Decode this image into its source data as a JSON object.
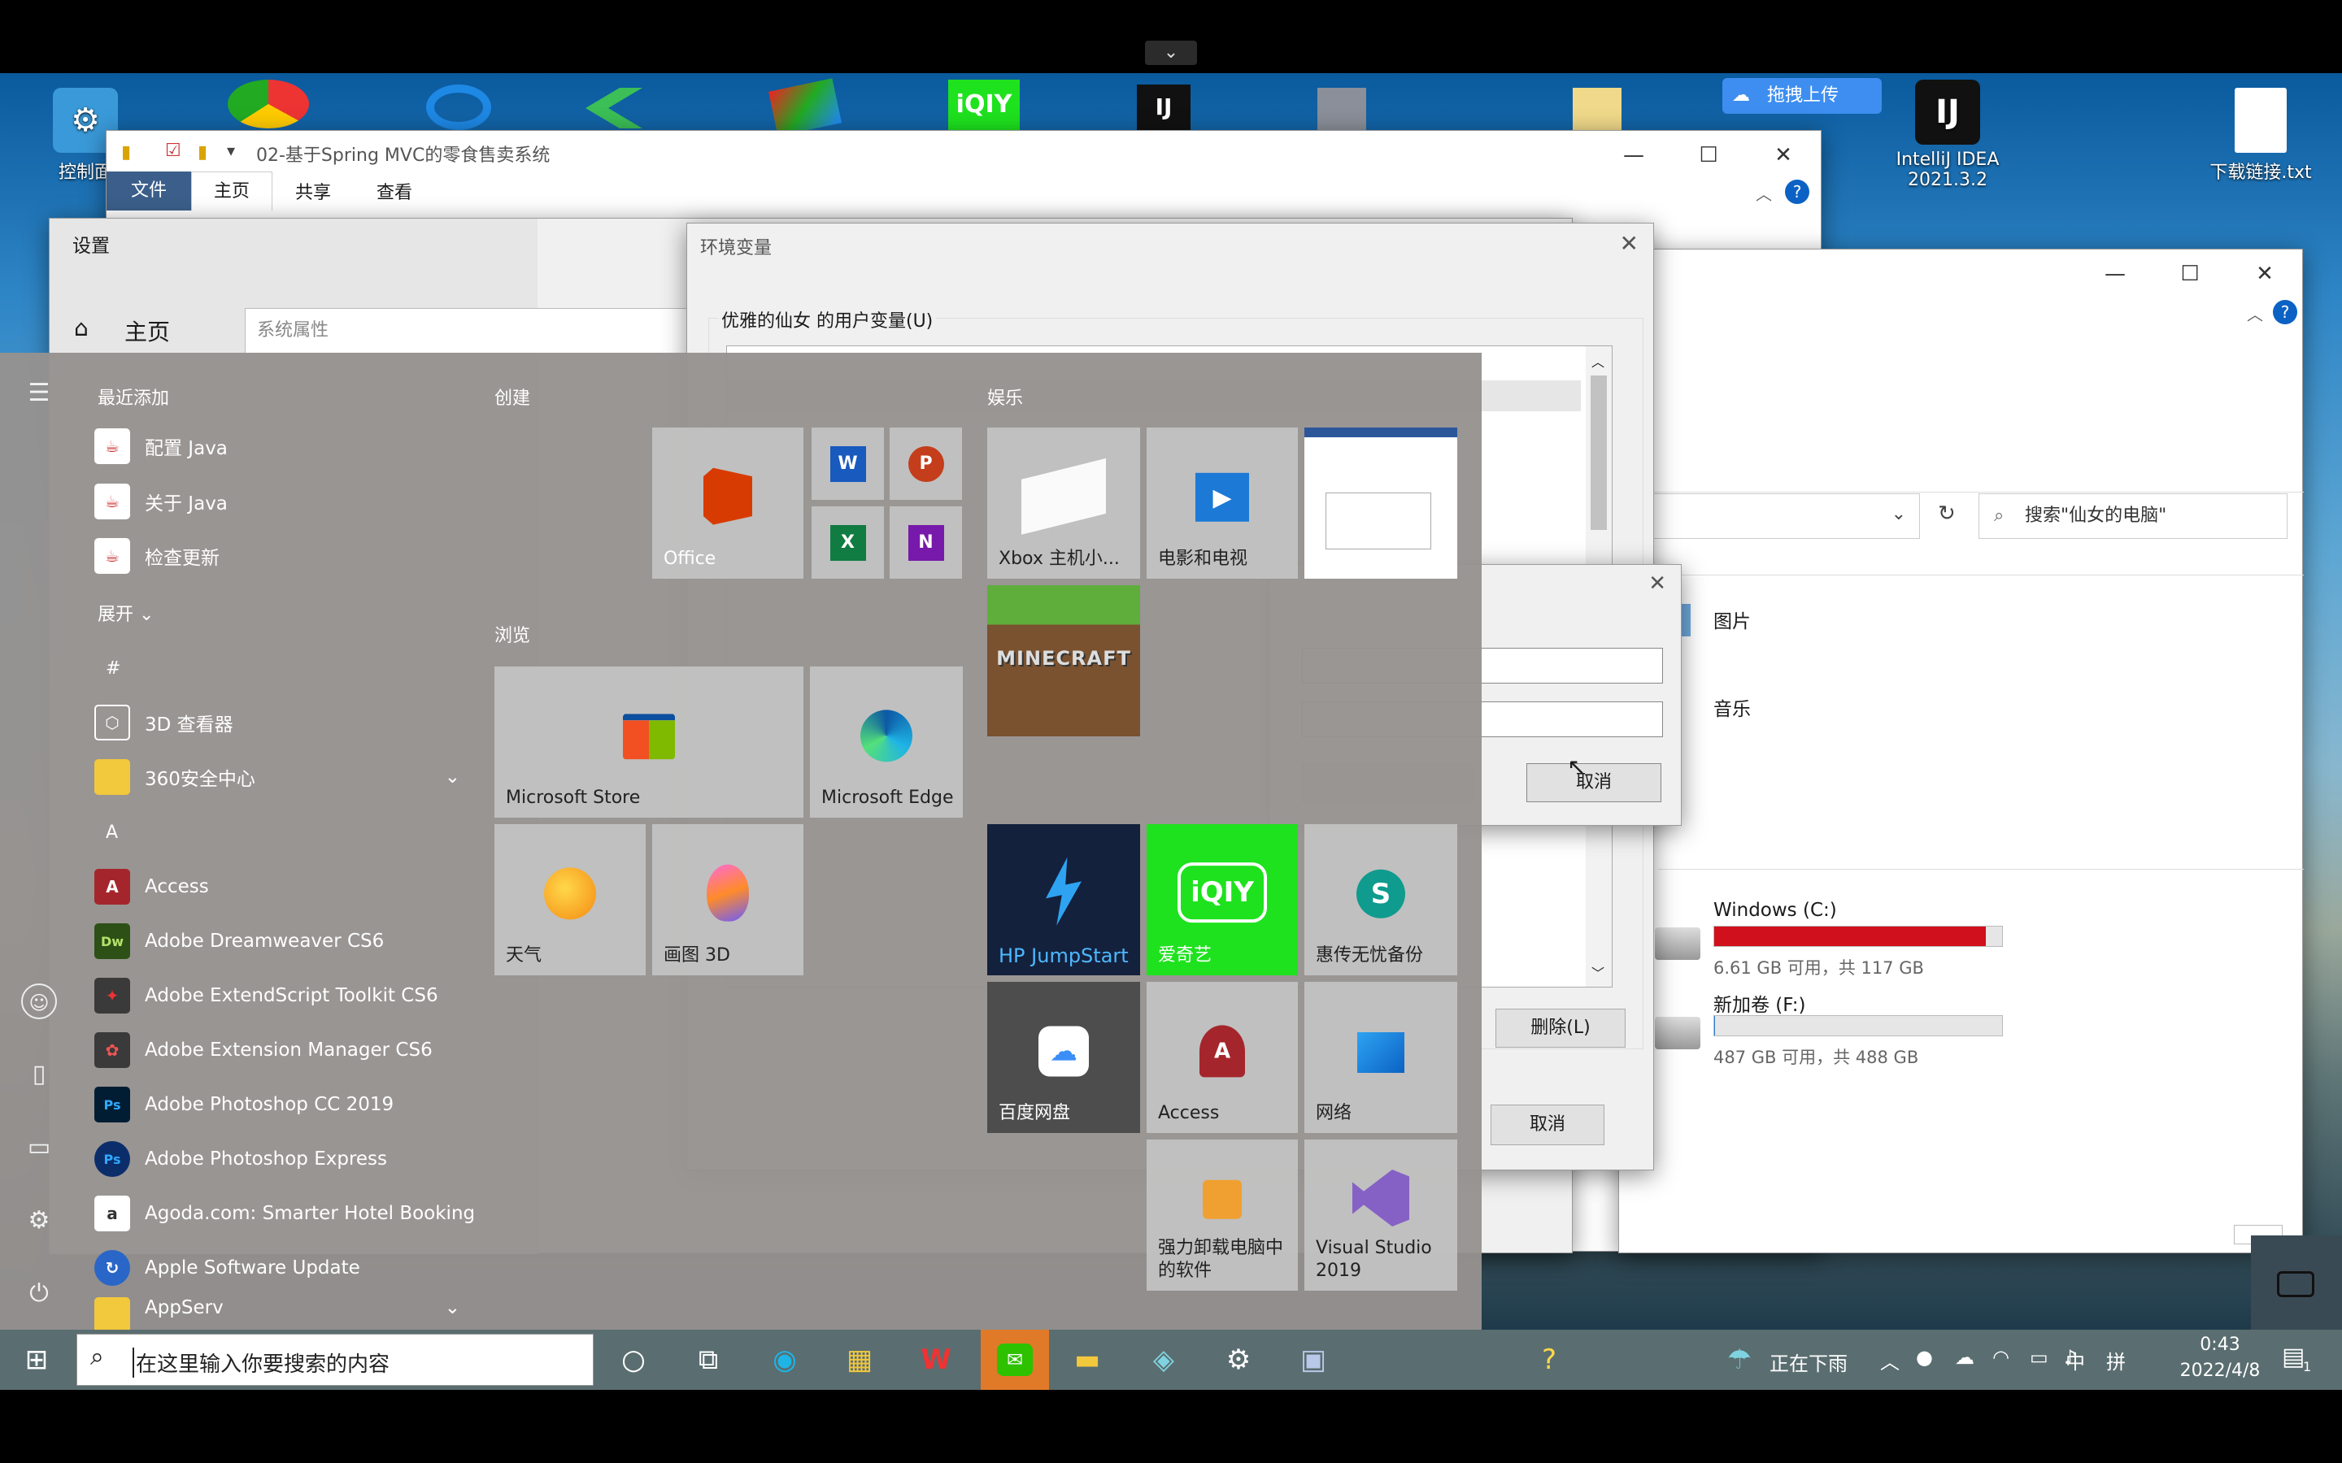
{
  "colors": {
    "drive_red": "#d0101c",
    "iqiyi_green": "#1ee21e",
    "tile_grey": "#c3c3c3",
    "accent_blue": "#0b62c4"
  },
  "desktop": {
    "icons": [
      {
        "label": "控制面",
        "icon": "control-panel-icon"
      },
      {
        "label": "IntelliJ IDEA\n2021.3.2",
        "icon": "intellij-icon"
      },
      {
        "label": "下载链接.txt",
        "icon": "text-file-icon"
      }
    ],
    "upload_badge": "拖拽上传"
  },
  "explorer_top": {
    "title": "02-基于Spring MVC的零食售卖系统",
    "ribbon_tabs": [
      "文件",
      "主页",
      "共享",
      "查看"
    ]
  },
  "settings": {
    "title": "设置",
    "home": "主页",
    "search_placeholder": "系统属性"
  },
  "env_dialog": {
    "title": "环境变量",
    "user_vars_label": "优雅的仙女 的用户变量(U)",
    "delete_button": "删除(L)",
    "cancel_button": "取消"
  },
  "small_dialog": {
    "cancel_button": "取消"
  },
  "explorer_right": {
    "search_placeholder": "搜索\"仙女的电脑\"",
    "folders": [
      "图片",
      "音乐"
    ],
    "drives": [
      {
        "name": "Windows (C:)",
        "info": "6.61 GB 可用，共 117 GB",
        "used_fraction": 0.944
      },
      {
        "name": "新加卷 (F:)",
        "info": "487 GB 可用，共 488 GB",
        "used_fraction": 0.002
      }
    ]
  },
  "start_menu": {
    "recent_title": "最近添加",
    "recent": [
      "配置 Java",
      "关于 Java",
      "检查更新"
    ],
    "expand": "展开",
    "sections": [
      {
        "letter": "#",
        "apps": [
          "3D 查看器",
          "360安全中心"
        ]
      },
      {
        "letter": "A",
        "apps": [
          "Access",
          "Adobe Dreamweaver CS6",
          "Adobe ExtendScript Toolkit CS6",
          "Adobe Extension Manager CS6",
          "Adobe Photoshop CC 2019",
          "Adobe Photoshop Express",
          "Agoda.com: Smarter Hotel Booking",
          "Apple Software Update",
          "AppServ"
        ]
      }
    ],
    "groups": {
      "create": "创建",
      "browse": "浏览",
      "entertainment": "娱乐"
    },
    "tiles": {
      "office": "Office",
      "store": "Microsoft Store",
      "edge": "Microsoft Edge",
      "weather": "天气",
      "paint3d": "画图 3D",
      "xbox": "Xbox 主机小...",
      "movies": "电影和电视",
      "hp": "HP JumpStart",
      "iqiyi": "爱奇艺",
      "backup": "惠传无忧备份",
      "baidu": "百度网盘",
      "access": "Access",
      "network": "网络",
      "uninstall": "强力卸载电脑中的软件",
      "vs": "Visual Studio 2019"
    }
  },
  "taskbar": {
    "search_placeholder": "在这里输入你要搜索的内容",
    "weather": "正在下雨",
    "ime_lang": "中",
    "ime_mode": "拼",
    "time": "0:43",
    "date": "2022/4/8",
    "notification_count": "1"
  }
}
